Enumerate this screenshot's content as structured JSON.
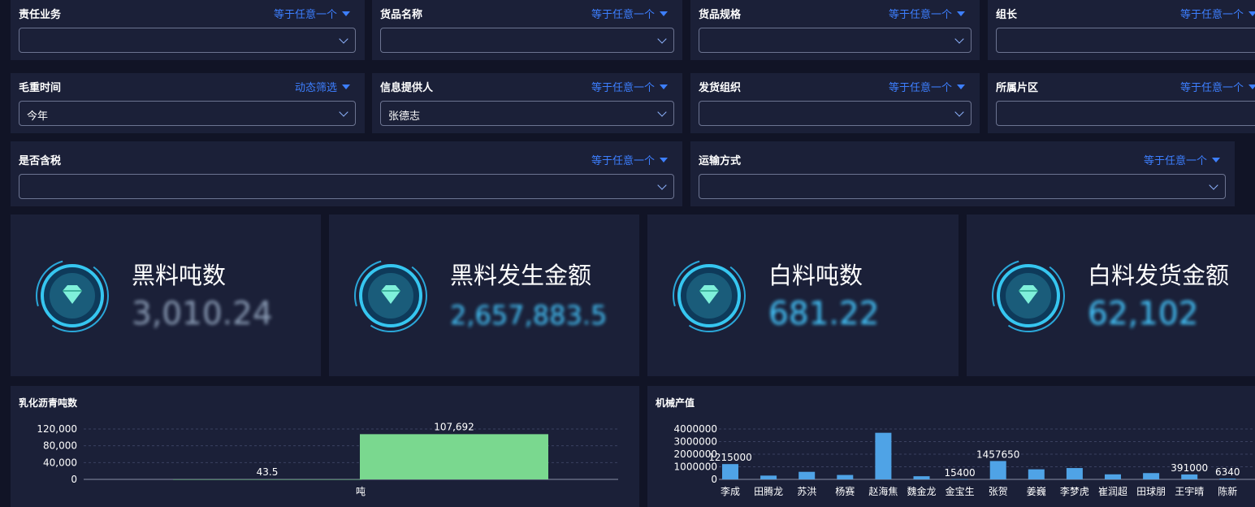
{
  "filters": [
    {
      "id": "f1",
      "label": "责任业务",
      "mode": "等于任意一个",
      "value": ""
    },
    {
      "id": "f2",
      "label": "货品名称",
      "mode": "等于任意一个",
      "value": ""
    },
    {
      "id": "f3",
      "label": "货品规格",
      "mode": "等于任意一个",
      "value": ""
    },
    {
      "id": "f4",
      "label": "组长",
      "mode": "等于任意一个",
      "value": ""
    },
    {
      "id": "f5",
      "label": "毛重时间",
      "mode": "动态筛选",
      "value": "今年"
    },
    {
      "id": "f6",
      "label": "信息提供人",
      "mode": "等于任意一个",
      "value": "张德志"
    },
    {
      "id": "f7",
      "label": "发货组织",
      "mode": "等于任意一个",
      "value": ""
    },
    {
      "id": "f8",
      "label": "所属片区",
      "mode": "等于任意一个",
      "value": ""
    },
    {
      "id": "f9",
      "label": "是否含税",
      "mode": "等于任意一个",
      "value": ""
    },
    {
      "id": "f10",
      "label": "运输方式",
      "mode": "等于任意一个",
      "value": ""
    }
  ],
  "kpis": [
    {
      "title": "黑料吨数",
      "value": "3,010.24",
      "icon": "diamond-icon"
    },
    {
      "title": "黑料发生金额",
      "value": "2,657,883.5",
      "icon": "diamond-icon"
    },
    {
      "title": "白料吨数",
      "value": "681.22",
      "icon": "diamond-icon"
    },
    {
      "title": "白料发货金额",
      "value": "62,102",
      "icon": "diamond-icon"
    }
  ],
  "colors": {
    "accent": "#3d7fff",
    "kpi_value": "#45c8ff",
    "bar_green": "#7ad88f",
    "bar_blue": "#4fa3e6",
    "panel": "#1b2038",
    "background": "#111426"
  },
  "chart_data": [
    {
      "type": "bar",
      "title": "乳化沥青吨数",
      "categories": [
        "吨"
      ],
      "series": [
        {
          "values": [
            43.5
          ]
        },
        {
          "values": [
            107692
          ]
        }
      ],
      "data_labels": [
        "43.5",
        "107,692"
      ],
      "yticks": [
        "120,000",
        "80,000",
        "40,000",
        "0"
      ],
      "ylim": [
        0,
        120000
      ]
    },
    {
      "type": "bar",
      "title": "机械产值",
      "categories": [
        "李成",
        "田腾龙",
        "苏洪",
        "杨赛",
        "赵海焦",
        "魏金龙",
        "金宝生",
        "张贺",
        "姜巍",
        "李梦虎",
        "崔润超",
        "田球朋",
        "王宇晴",
        "陈新"
      ],
      "values": [
        1215000,
        300000,
        600000,
        350000,
        3700000,
        250000,
        15400,
        1457650,
        800000,
        900000,
        400000,
        500000,
        391000,
        63400
      ],
      "data_labels": [
        "1215000",
        "",
        "",
        "",
        "",
        "",
        "15400",
        "1457650",
        "",
        "",
        "",
        "",
        "391000",
        "6340"
      ],
      "yticks": [
        "4000000",
        "3000000",
        "2000000",
        "1000000",
        "0"
      ],
      "ylim": [
        0,
        4000000
      ]
    }
  ]
}
